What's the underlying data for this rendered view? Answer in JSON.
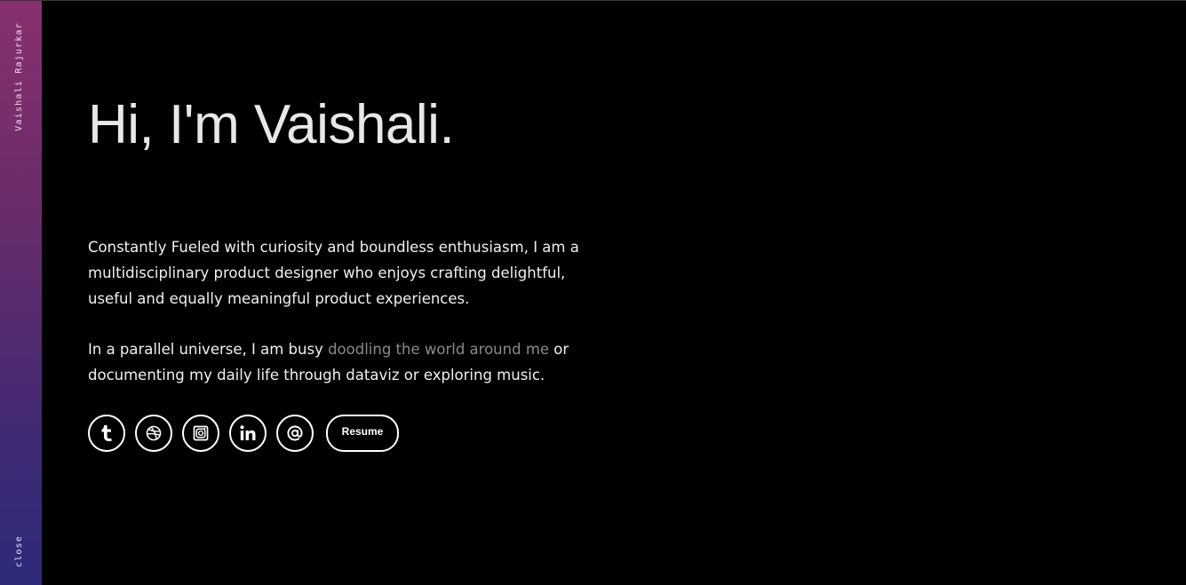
{
  "sidebar": {
    "name": "Vaishali Rajurkar",
    "close_label": "close",
    "gradient_colors": [
      "#88306e",
      "#2d2a7a"
    ]
  },
  "hero": {
    "greeting": "Hi, I'm Vaishali."
  },
  "bio": {
    "paragraph1": "Constantly Fueled with curiosity and boundless enthusiasm, I am a multidisciplinary product designer who enjoys crafting delightful, useful and equally meaningful product experiences.",
    "paragraph2_before": "In a parallel universe, I am busy ",
    "paragraph2_link": "doodling the world around me",
    "paragraph2_after": " or documenting my daily life through dataviz or exploring music."
  },
  "social_links": [
    {
      "icon": "tumblr-icon"
    },
    {
      "icon": "dribbble-icon"
    },
    {
      "icon": "instagram-icon"
    },
    {
      "icon": "linkedin-icon"
    },
    {
      "icon": "email-at-icon"
    }
  ],
  "resume": {
    "label": "Resume"
  },
  "colors": {
    "background": "#000000",
    "text": "#f0f0f0",
    "muted_link": "#8a8a8a",
    "icon_outline": "#ffffff"
  }
}
